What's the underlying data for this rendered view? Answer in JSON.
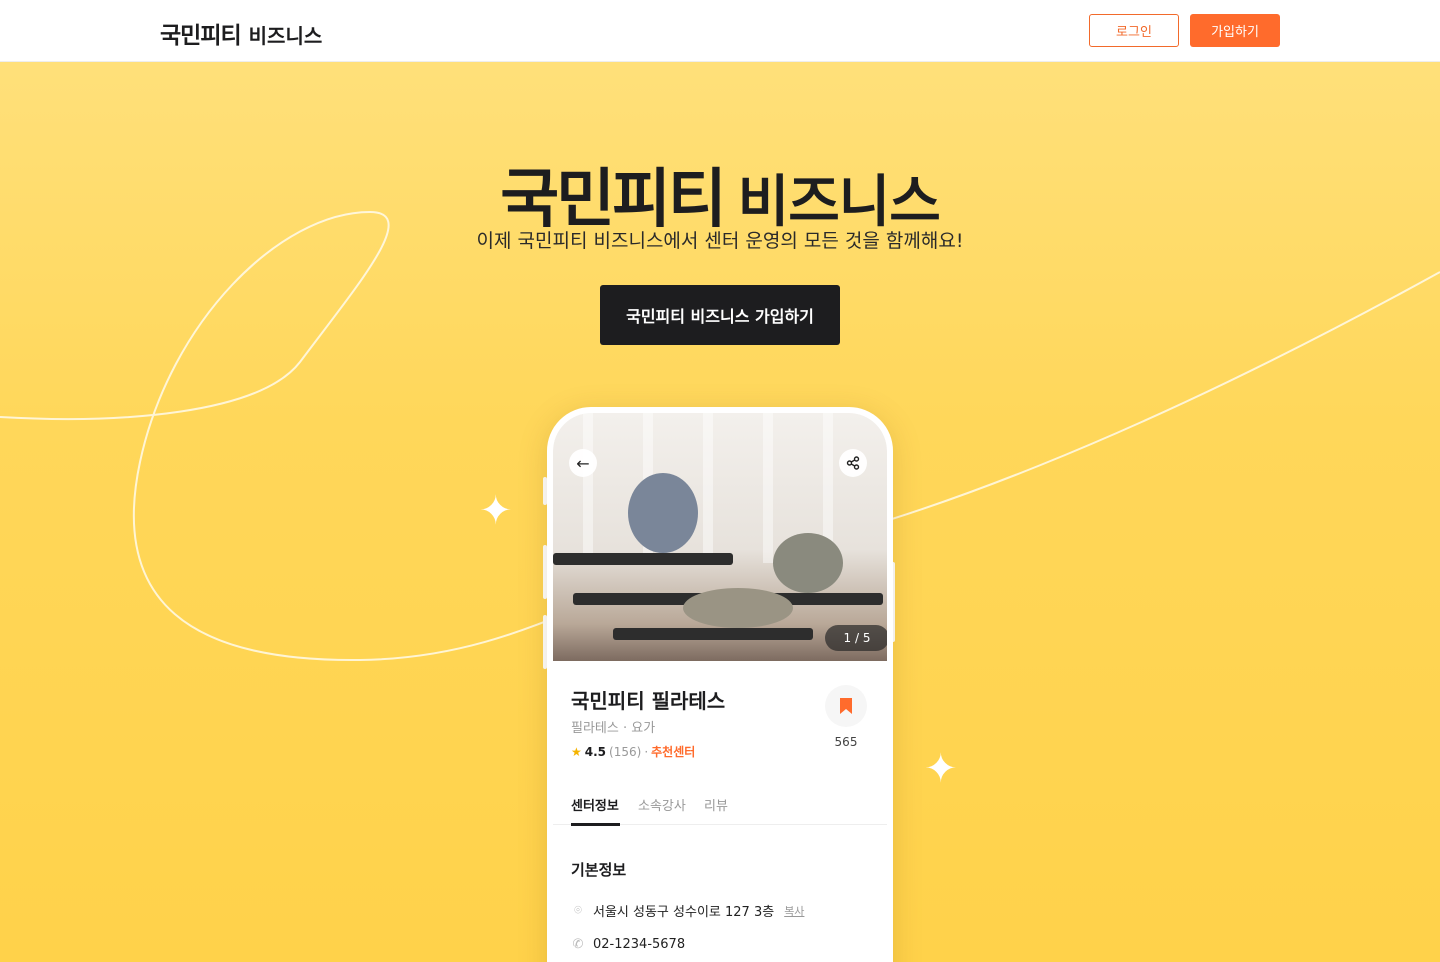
{
  "header": {
    "logo_brand": "국민피티",
    "logo_biz": "비즈니스",
    "login_label": "로그인",
    "signup_label": "가입하기"
  },
  "hero": {
    "title_brand": "국민피티",
    "title_biz": "비즈니스",
    "subtitle": "이제 국민피티 비즈니스에서 센터 운영의 모든 것을 함께해요!",
    "cta_label": "국민피티 비즈니스 가입하기"
  },
  "phone": {
    "photo_counter": "1 / 5",
    "center_name": "국민피티 필라테스",
    "category": "필라테스 · 요가",
    "rating": "4.5",
    "rating_count": "(156)",
    "separator": "·",
    "recommend_label": "추천센터",
    "bookmark_count": "565",
    "tabs": [
      {
        "label": "센터정보",
        "active": true
      },
      {
        "label": "소속강사",
        "active": false
      },
      {
        "label": "리뷰",
        "active": false
      }
    ],
    "section_title": "기본정보",
    "address": "서울시 성동구 성수이로 127 3층",
    "copy_label": "복사",
    "phone_number": "02-1234-5678"
  },
  "icons": {
    "back": "arrow-left-icon",
    "share": "share-icon",
    "bookmark": "bookmark-icon",
    "star": "star-icon",
    "location": "location-pin-icon",
    "phone": "phone-icon"
  },
  "colors": {
    "accent": "#ff6b2c",
    "hero_bg": "#ffd75a",
    "dark": "#1d1d1f"
  }
}
